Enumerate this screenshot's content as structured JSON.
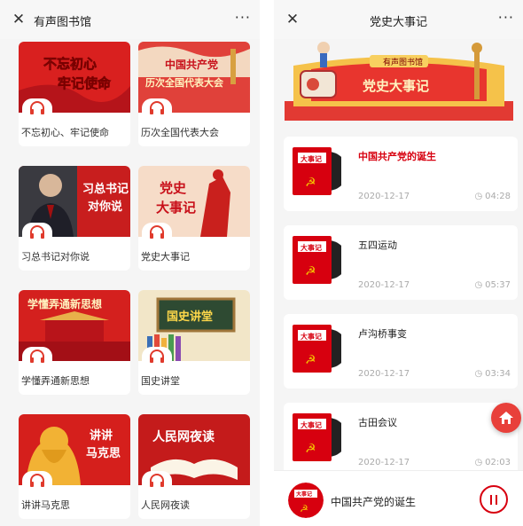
{
  "left": {
    "title": "有声图书馆",
    "more": "···",
    "close": "✕",
    "cards": [
      {
        "thumb_text": "不忘初心\n牢记使命",
        "label": "不忘初心、牢记使命"
      },
      {
        "thumb_text": "中国共产党\n历次全国代表大会",
        "label": "历次全国代表大会"
      },
      {
        "thumb_text": "习总书记\n对你说",
        "label": "习总书记对你说"
      },
      {
        "thumb_text": "党史\n大事记",
        "label": "党史大事记"
      },
      {
        "thumb_text": "学懂弄通新思想",
        "label": "学懂弄通新思想"
      },
      {
        "thumb_text": "国史讲堂",
        "label": "国史讲堂"
      },
      {
        "thumb_text": "讲讲\n马克思",
        "label": "讲讲马克思"
      },
      {
        "thumb_text": "人民网夜读",
        "label": "人民网夜读"
      }
    ]
  },
  "right": {
    "title": "党史大事记",
    "more": "···",
    "close": "✕",
    "banner": {
      "small": "有声图书馆",
      "big": "党史大事记"
    },
    "cover_label": "大事记",
    "items": [
      {
        "title": "中国共产党的诞生",
        "date": "2020-12-17",
        "duration": "04:28",
        "active": true
      },
      {
        "title": "五四运动",
        "date": "2020-12-17",
        "duration": "05:37",
        "active": false
      },
      {
        "title": "卢沟桥事变",
        "date": "2020-12-17",
        "duration": "03:34",
        "active": false
      },
      {
        "title": "古田会议",
        "date": "2020-12-17",
        "duration": "02:03",
        "active": false
      }
    ],
    "player": {
      "title": "中国共产党的诞生",
      "disc_label": "大事记"
    }
  }
}
